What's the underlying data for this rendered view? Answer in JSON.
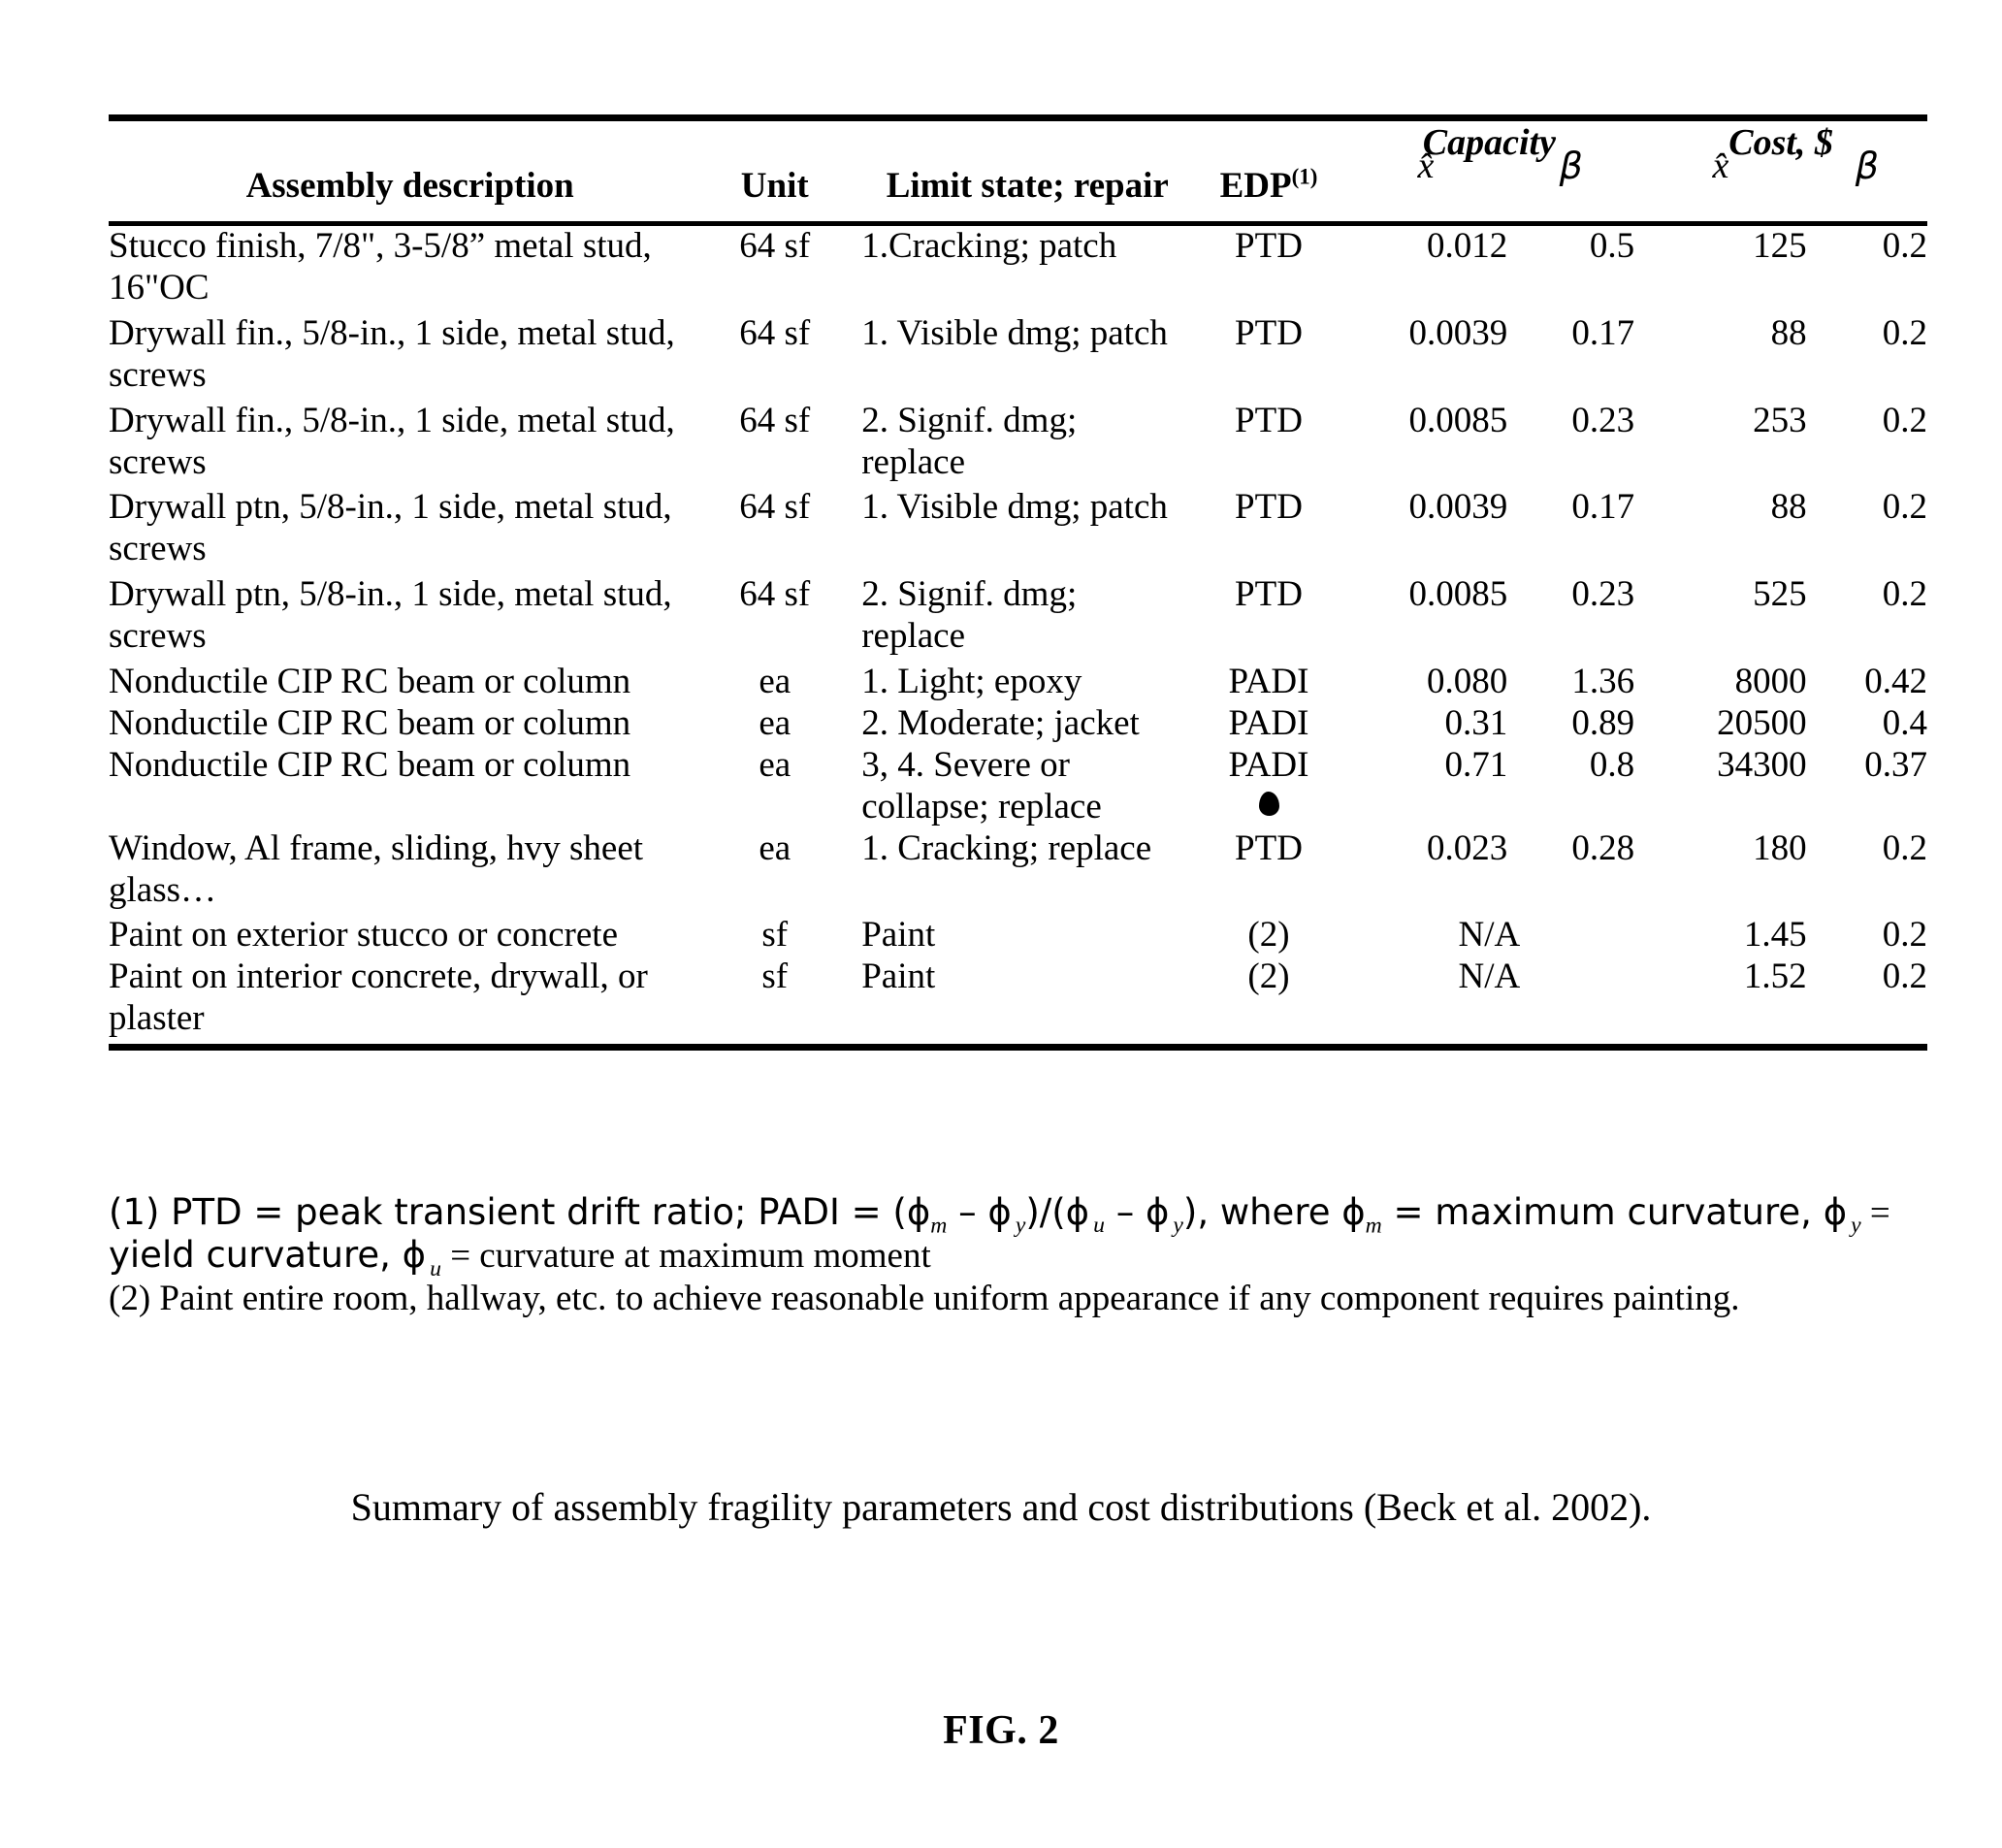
{
  "document": {
    "figure_label": "FIG. 2",
    "caption": "Summary of assembly fragility parameters and cost distributions (Beck et al. 2002)."
  },
  "table": {
    "group_headers": {
      "capacity": "Capacity",
      "cost": "Cost, $"
    },
    "columns": {
      "description": "Assembly description",
      "unit": "Unit",
      "limit_state": "Limit state; repair",
      "edp": "EDP",
      "edp_superscript": "(1)",
      "capacity_xhat": "x̂",
      "capacity_beta": "β",
      "cost_xhat": "x̂",
      "cost_beta": "β"
    },
    "rows": [
      {
        "description": "Stucco finish, 7/8\", 3-5/8” metal stud, 16\"OC",
        "unit": "64 sf",
        "limit_state": "1.Cracking; patch",
        "edp": "PTD",
        "capacity_xhat": "0.012",
        "capacity_beta": "0.5",
        "cost_xhat": "125",
        "cost_beta": "0.2"
      },
      {
        "description": "Drywall fin., 5/8-in., 1 side, metal stud, screws",
        "unit": "64 sf",
        "limit_state": "1. Visible dmg; patch",
        "edp": "PTD",
        "capacity_xhat": "0.0039",
        "capacity_beta": "0.17",
        "cost_xhat": "88",
        "cost_beta": "0.2"
      },
      {
        "description": "Drywall fin., 5/8-in., 1 side, metal stud, screws",
        "unit": "64 sf",
        "limit_state": "2. Signif. dmg; replace",
        "edp": "PTD",
        "capacity_xhat": "0.0085",
        "capacity_beta": "0.23",
        "cost_xhat": "253",
        "cost_beta": "0.2"
      },
      {
        "description": "Drywall ptn, 5/8-in., 1 side, metal stud, screws",
        "unit": "64 sf",
        "limit_state": "1. Visible dmg; patch",
        "edp": "PTD",
        "capacity_xhat": "0.0039",
        "capacity_beta": "0.17",
        "cost_xhat": "88",
        "cost_beta": "0.2"
      },
      {
        "description": "Drywall ptn, 5/8-in., 1 side, metal stud, screws",
        "unit": "64 sf",
        "limit_state": "2. Signif. dmg; replace",
        "edp": "PTD",
        "capacity_xhat": "0.0085",
        "capacity_beta": "0.23",
        "cost_xhat": "525",
        "cost_beta": "0.2"
      },
      {
        "description": "Nonductile CIP RC beam or column",
        "unit": "ea",
        "limit_state": "1. Light; epoxy",
        "edp": "PADI",
        "capacity_xhat": "0.080",
        "capacity_beta": "1.36",
        "cost_xhat": "8000",
        "cost_beta": "0.42"
      },
      {
        "description": "Nonductile CIP RC beam or column",
        "unit": "ea",
        "limit_state": "2. Moderate; jacket",
        "edp": "PADI",
        "capacity_xhat": "0.31",
        "capacity_beta": "0.89",
        "cost_xhat": "20500",
        "cost_beta": "0.4"
      },
      {
        "description": "Nonductile CIP RC beam or column",
        "unit": "ea",
        "limit_state": "3, 4. Severe or collapse; replace",
        "edp": "PADI",
        "capacity_xhat": "0.71",
        "capacity_beta": "0.8",
        "cost_xhat": "34300",
        "cost_beta": "0.37"
      },
      {
        "description": "Window, Al frame, sliding, hvy sheet glass…",
        "unit": "ea",
        "limit_state": "1. Cracking; replace",
        "edp": "PTD",
        "capacity_xhat": "0.023",
        "capacity_beta": "0.28",
        "cost_xhat": "180",
        "cost_beta": "0.2"
      },
      {
        "description": "Paint on exterior stucco or concrete",
        "unit": "sf",
        "limit_state": "Paint",
        "edp": "(2)",
        "capacity_na": "N/A",
        "cost_xhat": "1.45",
        "cost_beta": "0.2"
      },
      {
        "description": "Paint on interior concrete, drywall, or plaster",
        "unit": "sf",
        "limit_state": "Paint",
        "edp": "(2)",
        "capacity_na": "N/A",
        "cost_xhat": "1.52",
        "cost_beta": "0.2"
      }
    ]
  },
  "footnotes": {
    "note1_a": "(1) PTD = peak transient drift ratio; PADI = (ϕ",
    "note1_b": "m",
    "note1_c": " – ϕ",
    "note1_d": "y",
    "note1_e": ")/(ϕ",
    "note1_f": "u",
    "note1_g": " – ϕ",
    "note1_h": "y",
    "note1_i": "), where ϕ",
    "note1_j": "m",
    "note1_k": " = maximum curvature, ϕ",
    "note1_l": "y",
    "note1_m": " =",
    "note1_line2_a": "yield curvature, ϕ",
    "note1_line2_b": "u",
    "note1_line2_c": " = curvature at maximum moment",
    "note2": "(2) Paint entire room, hallway, etc. to achieve reasonable uniform appearance if any component requires painting."
  }
}
